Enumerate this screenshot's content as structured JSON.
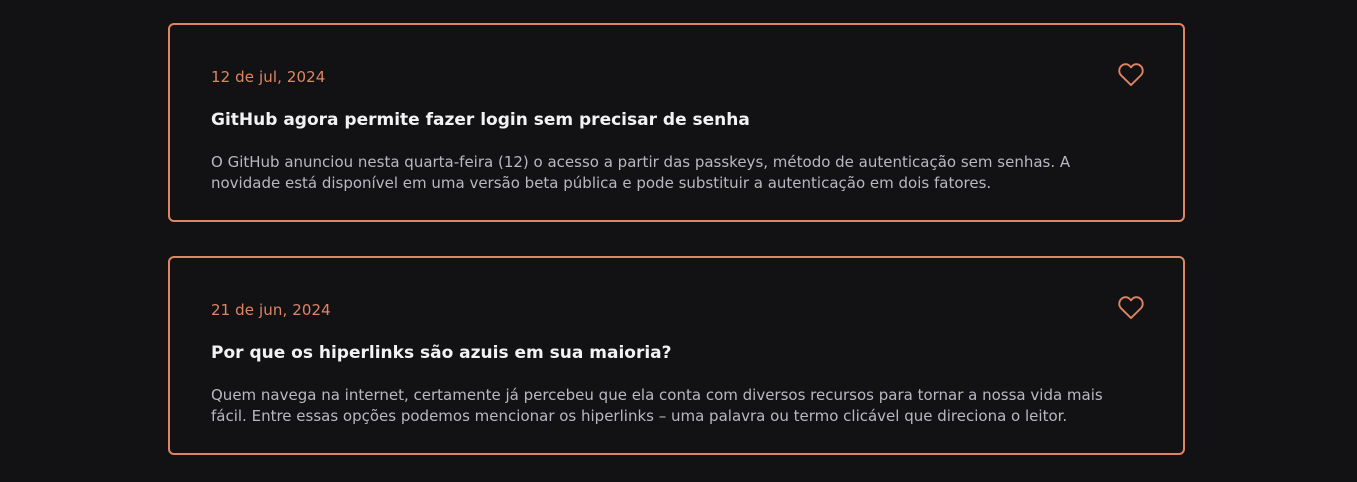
{
  "colors": {
    "accent": "#e08564",
    "background": "#121214",
    "title": "#f2f2f4",
    "body": "#b8b8c0"
  },
  "posts": [
    {
      "date": "12 de jul, 2024",
      "title": "GitHub agora permite fazer login sem precisar de senha",
      "excerpt": "O GitHub anunciou nesta quarta-feira (12) o acesso a partir das passkeys, método de autenticação sem senhas. A novidade está disponível em uma versão beta pública e pode substituir a autenticação em dois fatores.",
      "favorite_icon": "heart-outline-icon"
    },
    {
      "date": "21 de jun, 2024",
      "title": "Por que os hiperlinks são azuis em sua maioria?",
      "excerpt": "Quem navega na internet, certamente já percebeu que ela conta com diversos recursos para tornar a nossa vida mais fácil. Entre essas opções podemos mencionar os hiperlinks – uma palavra ou termo clicável que direciona o leitor.",
      "favorite_icon": "heart-outline-icon"
    }
  ]
}
